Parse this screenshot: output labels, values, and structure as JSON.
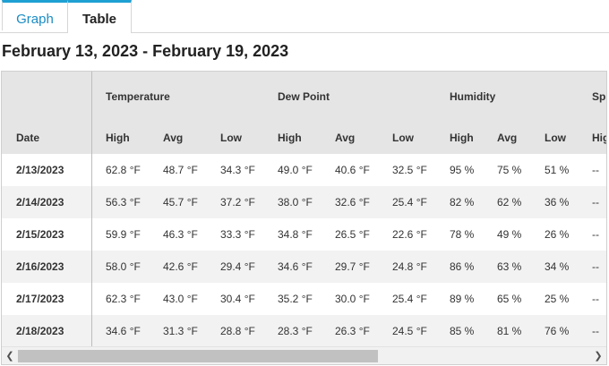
{
  "tabs": [
    {
      "label": "Graph",
      "active": false
    },
    {
      "label": "Table",
      "active": true
    }
  ],
  "heading": "February 13, 2023 - February 19, 2023",
  "table": {
    "groups": [
      "Temperature",
      "Dew Point",
      "Humidity",
      "Sp"
    ],
    "date_header": "Date",
    "subheaders": [
      "High",
      "Avg",
      "Low",
      "High",
      "Avg",
      "Low",
      "High",
      "Avg",
      "Low",
      "Hig"
    ],
    "rows": [
      {
        "date": "2/13/2023",
        "cells": [
          "62.8 °F",
          "48.7 °F",
          "34.3 °F",
          "49.0 °F",
          "40.6 °F",
          "32.5 °F",
          "95 %",
          "75 %",
          "51 %",
          "--"
        ]
      },
      {
        "date": "2/14/2023",
        "cells": [
          "56.3 °F",
          "45.7 °F",
          "37.2 °F",
          "38.0 °F",
          "32.6 °F",
          "25.4 °F",
          "82 %",
          "62 %",
          "36 %",
          "--"
        ]
      },
      {
        "date": "2/15/2023",
        "cells": [
          "59.9 °F",
          "46.3 °F",
          "33.3 °F",
          "34.8 °F",
          "26.5 °F",
          "22.6 °F",
          "78 %",
          "49 %",
          "26 %",
          "--"
        ]
      },
      {
        "date": "2/16/2023",
        "cells": [
          "58.0 °F",
          "42.6 °F",
          "29.4 °F",
          "34.6 °F",
          "29.7 °F",
          "24.8 °F",
          "86 %",
          "63 %",
          "34 %",
          "--"
        ]
      },
      {
        "date": "2/17/2023",
        "cells": [
          "62.3 °F",
          "43.0 °F",
          "30.4 °F",
          "35.2 °F",
          "30.0 °F",
          "25.4 °F",
          "89 %",
          "65 %",
          "25 %",
          "--"
        ]
      },
      {
        "date": "2/18/2023",
        "cells": [
          "34.6 °F",
          "31.3 °F",
          "28.8 °F",
          "28.3 °F",
          "26.3 °F",
          "24.5 °F",
          "85 %",
          "81 %",
          "76 %",
          "--"
        ]
      }
    ]
  },
  "scrollbar": {
    "left_icon": "arrow-left-icon",
    "right_icon": "arrow-right-icon",
    "left_glyph": "❮",
    "right_glyph": "❯"
  },
  "colors": {
    "tab_accent": "#1fa0d3",
    "tab_link": "#1a8cc4",
    "header_bg": "#e5e5e5",
    "alt_row_bg": "#f2f2f2"
  }
}
